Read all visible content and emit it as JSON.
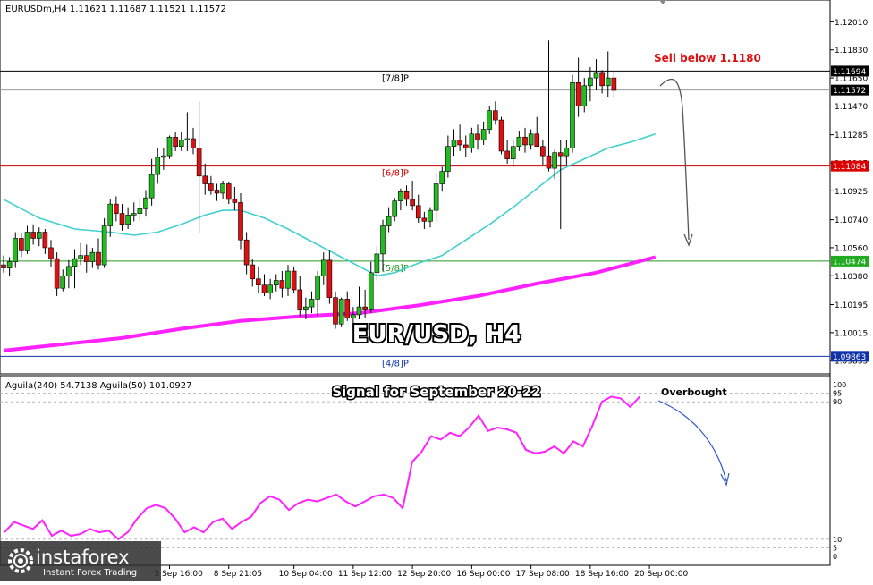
{
  "header": {
    "symbol_line": "EURUSDm,H4  1.11621 1.11687 1.11521 1.11572",
    "indicator_line": "Aguila(240) 54.7138  Aguila(50) 101.0927"
  },
  "title": "EUR/USD, H4",
  "subtitle": "Signal for September  20-22",
  "annotations": {
    "sell": "Sell below 1.1180",
    "overbought": "Overbought"
  },
  "levels": {
    "l78": {
      "label": "[7/8]P",
      "price": 1.11694,
      "tag": "1.11694"
    },
    "l68": {
      "label": "[6/8]P",
      "price": 1.11084,
      "tag": "1.11084"
    },
    "l58": {
      "label": "[5/8]P",
      "price": 1.10474,
      "tag": "1.10474"
    },
    "l48": {
      "label": "[4/8]P",
      "price": 1.09863,
      "tag": "1.09863"
    },
    "current": {
      "price": 1.11572,
      "tag": "1.11572"
    }
  },
  "colors": {
    "bull": "#22bb22",
    "bear": "#dd1111",
    "ma_slow": "#ff22ff",
    "ma_fast": "#40d0d0",
    "osc": "#ff22ff",
    "level_line": "#cc0000",
    "sell_text": "#dd1111",
    "green_tag": "#22aa22",
    "red_tag": "#dd0000",
    "blue_tag": "#1133aa"
  },
  "logo": {
    "brand": "instaforex",
    "tagline": "Instant Forex Trading"
  },
  "chart_data": {
    "type": "candlestick",
    "symbol": "EURUSDm",
    "timeframe": "H4",
    "ylim": [
      1.0975,
      1.1215
    ],
    "price_ticks": [
      "1.12010",
      "1.11830",
      "1.11650",
      "1.11470",
      "1.11285",
      "1.11105",
      "1.10925",
      "1.10740",
      "1.10560",
      "1.10380",
      "1.10195",
      "1.10015",
      "1.09835"
    ],
    "x_ticks": [
      "5 Sep 16:00",
      "8 Sep 21:05",
      "10 Sep 04:00",
      "11 Sep 12:00",
      "12 Sep 20:00",
      "16 Sep 00:00",
      "17 Sep 08:00",
      "18 Sep 16:00",
      "20 Sep 00:00"
    ],
    "x_tick_index": [
      28,
      38,
      49,
      59,
      69,
      79,
      89,
      99,
      109
    ],
    "candles": [
      [
        1.1045,
        1.1051,
        1.104,
        1.1043
      ],
      [
        1.1043,
        1.105,
        1.1038,
        1.1047
      ],
      [
        1.1047,
        1.1066,
        1.1043,
        1.1062
      ],
      [
        1.1062,
        1.1065,
        1.105,
        1.1054
      ],
      [
        1.1054,
        1.107,
        1.1052,
        1.1066
      ],
      [
        1.1066,
        1.1071,
        1.1058,
        1.1062
      ],
      [
        1.1062,
        1.1069,
        1.1057,
        1.1066
      ],
      [
        1.1066,
        1.1068,
        1.1052,
        1.1056
      ],
      [
        1.1056,
        1.1061,
        1.1044,
        1.1049
      ],
      [
        1.1049,
        1.1053,
        1.1025,
        1.103
      ],
      [
        1.103,
        1.1042,
        1.1028,
        1.1038
      ],
      [
        1.1038,
        1.1048,
        1.103,
        1.1044
      ],
      [
        1.1044,
        1.1055,
        1.103,
        1.1049
      ],
      [
        1.1049,
        1.1059,
        1.1045,
        1.1051
      ],
      [
        1.1051,
        1.1058,
        1.104,
        1.1047
      ],
      [
        1.1047,
        1.1056,
        1.1043,
        1.1053
      ],
      [
        1.1053,
        1.1062,
        1.1042,
        1.1045
      ],
      [
        1.1045,
        1.1075,
        1.1043,
        1.107
      ],
      [
        1.107,
        1.1087,
        1.1063,
        1.1084
      ],
      [
        1.1084,
        1.1089,
        1.1073,
        1.1078
      ],
      [
        1.1078,
        1.1084,
        1.1067,
        1.1071
      ],
      [
        1.1071,
        1.1082,
        1.1068,
        1.1077
      ],
      [
        1.1077,
        1.1085,
        1.1073,
        1.1078
      ],
      [
        1.1078,
        1.1087,
        1.1073,
        1.1081
      ],
      [
        1.1081,
        1.1093,
        1.1076,
        1.1088
      ],
      [
        1.1088,
        1.1113,
        1.1083,
        1.1103
      ],
      [
        1.1103,
        1.112,
        1.1097,
        1.1114
      ],
      [
        1.1114,
        1.112,
        1.1106,
        1.1115
      ],
      [
        1.1115,
        1.1128,
        1.1113,
        1.1127
      ],
      [
        1.1127,
        1.113,
        1.1118,
        1.1121
      ],
      [
        1.1121,
        1.113,
        1.1118,
        1.1125
      ],
      [
        1.1125,
        1.1143,
        1.1118,
        1.1126
      ],
      [
        1.1126,
        1.1133,
        1.1116,
        1.112
      ],
      [
        1.112,
        1.115,
        1.1065,
        1.1102
      ],
      [
        1.1102,
        1.111,
        1.109,
        1.1097
      ],
      [
        1.1097,
        1.1102,
        1.109,
        1.1093
      ],
      [
        1.1093,
        1.1097,
        1.1086,
        1.1091
      ],
      [
        1.1091,
        1.1099,
        1.1087,
        1.1097
      ],
      [
        1.1097,
        1.1098,
        1.1084,
        1.1087
      ],
      [
        1.1087,
        1.1095,
        1.108,
        1.1085
      ],
      [
        1.1085,
        1.1091,
        1.1055,
        1.1061
      ],
      [
        1.1061,
        1.1066,
        1.1039,
        1.1045
      ],
      [
        1.1045,
        1.1049,
        1.1031,
        1.1036
      ],
      [
        1.1036,
        1.1044,
        1.1027,
        1.1032
      ],
      [
        1.1032,
        1.1039,
        1.1025,
        1.1027
      ],
      [
        1.1027,
        1.1036,
        1.1023,
        1.1032
      ],
      [
        1.1032,
        1.1039,
        1.1028,
        1.1035
      ],
      [
        1.1035,
        1.1041,
        1.1024,
        1.103
      ],
      [
        1.103,
        1.1045,
        1.1025,
        1.1041
      ],
      [
        1.1041,
        1.1044,
        1.1027,
        1.1029
      ],
      [
        1.1029,
        1.1038,
        1.1012,
        1.1016
      ],
      [
        1.1016,
        1.1024,
        1.101,
        1.1018
      ],
      [
        1.1018,
        1.1028,
        1.1014,
        1.1023
      ],
      [
        1.1023,
        1.1041,
        1.1012,
        1.1038
      ],
      [
        1.1038,
        1.1053,
        1.1032,
        1.1048
      ],
      [
        1.1048,
        1.1054,
        1.102,
        1.1024
      ],
      [
        1.1024,
        1.1028,
        1.1004,
        1.1007
      ],
      [
        1.1007,
        1.1024,
        1.1005,
        1.1023
      ],
      [
        1.1023,
        1.1028,
        1.1009,
        1.1011
      ],
      [
        1.1011,
        1.1018,
        1.1003,
        1.1013
      ],
      [
        1.1013,
        1.1031,
        1.101,
        1.1018
      ],
      [
        1.1018,
        1.1029,
        1.1011,
        1.1016
      ],
      [
        1.1016,
        1.1047,
        1.1014,
        1.104
      ],
      [
        1.104,
        1.1057,
        1.1035,
        1.1052
      ],
      [
        1.1052,
        1.1074,
        1.1041,
        1.107
      ],
      [
        1.107,
        1.1082,
        1.1066,
        1.1076
      ],
      [
        1.1076,
        1.1088,
        1.1073,
        1.1086
      ],
      [
        1.1086,
        1.1094,
        1.108,
        1.1092
      ],
      [
        1.1092,
        1.1096,
        1.1083,
        1.1087
      ],
      [
        1.1087,
        1.1099,
        1.108,
        1.1083
      ],
      [
        1.1083,
        1.109,
        1.1072,
        1.1075
      ],
      [
        1.1075,
        1.1079,
        1.1068,
        1.1073
      ],
      [
        1.1073,
        1.1082,
        1.1069,
        1.108
      ],
      [
        1.108,
        1.1104,
        1.1073,
        1.1097
      ],
      [
        1.1097,
        1.1108,
        1.1092,
        1.1105
      ],
      [
        1.1105,
        1.1128,
        1.1101,
        1.1121
      ],
      [
        1.1121,
        1.1132,
        1.1115,
        1.1125
      ],
      [
        1.1125,
        1.1135,
        1.1118,
        1.1122
      ],
      [
        1.1122,
        1.1128,
        1.1114,
        1.112
      ],
      [
        1.112,
        1.1133,
        1.1117,
        1.1129
      ],
      [
        1.1129,
        1.1135,
        1.1119,
        1.1125
      ],
      [
        1.1125,
        1.1137,
        1.1122,
        1.1132
      ],
      [
        1.1132,
        1.1147,
        1.1129,
        1.1144
      ],
      [
        1.1144,
        1.115,
        1.1135,
        1.1138
      ],
      [
        1.1138,
        1.114,
        1.1116,
        1.1118
      ],
      [
        1.1118,
        1.1125,
        1.111,
        1.1113
      ],
      [
        1.1113,
        1.1125,
        1.1108,
        1.1121
      ],
      [
        1.1121,
        1.1131,
        1.1118,
        1.1127
      ],
      [
        1.1127,
        1.1133,
        1.1117,
        1.1122
      ],
      [
        1.1122,
        1.1132,
        1.1119,
        1.1129
      ],
      [
        1.1129,
        1.114,
        1.1126,
        1.1121
      ],
      [
        1.1121,
        1.1125,
        1.1109,
        1.1115
      ],
      [
        1.1115,
        1.1189,
        1.1105,
        1.1107
      ],
      [
        1.1107,
        1.1119,
        1.11,
        1.1117
      ],
      [
        1.1117,
        1.1125,
        1.1068,
        1.1115
      ],
      [
        1.1115,
        1.1125,
        1.1109,
        1.112
      ],
      [
        1.112,
        1.1167,
        1.1117,
        1.1162
      ],
      [
        1.1162,
        1.1178,
        1.114,
        1.1147
      ],
      [
        1.1147,
        1.1165,
        1.1143,
        1.116
      ],
      [
        1.116,
        1.1172,
        1.115,
        1.1165
      ],
      [
        1.1165,
        1.1177,
        1.1157,
        1.1168
      ],
      [
        1.1168,
        1.117,
        1.1155,
        1.116
      ],
      [
        1.116,
        1.1182,
        1.1153,
        1.1165
      ],
      [
        1.1165,
        1.1169,
        1.1152,
        1.1157
      ]
    ],
    "ma_fast": [
      [
        0,
        1.1087
      ],
      [
        6,
        1.1075
      ],
      [
        12,
        1.1068
      ],
      [
        18,
        1.1066
      ],
      [
        22,
        1.1064
      ],
      [
        26,
        1.1066
      ],
      [
        30,
        1.1071
      ],
      [
        34,
        1.1077
      ],
      [
        37,
        1.108
      ],
      [
        40,
        1.108
      ],
      [
        44,
        1.1075
      ],
      [
        48,
        1.1068
      ],
      [
        52,
        1.106
      ],
      [
        56,
        1.1052
      ],
      [
        60,
        1.1044
      ],
      [
        63,
        1.1038
      ],
      [
        66,
        1.104
      ],
      [
        70,
        1.1046
      ],
      [
        74,
        1.1051
      ],
      [
        78,
        1.1061
      ],
      [
        82,
        1.1071
      ],
      [
        86,
        1.1082
      ],
      [
        90,
        1.1094
      ],
      [
        94,
        1.1106
      ],
      [
        98,
        1.1113
      ],
      [
        102,
        1.112
      ],
      [
        106,
        1.1124
      ],
      [
        110,
        1.1129
      ]
    ],
    "ma_slow": [
      [
        0,
        1.099
      ],
      [
        10,
        1.0994
      ],
      [
        20,
        1.0998
      ],
      [
        30,
        1.1004
      ],
      [
        40,
        1.1009
      ],
      [
        50,
        1.1012
      ],
      [
        60,
        1.1014
      ],
      [
        70,
        1.1019
      ],
      [
        80,
        1.1025
      ],
      [
        90,
        1.1033
      ],
      [
        100,
        1.104
      ],
      [
        110,
        1.105
      ]
    ],
    "oscillator": {
      "ylim": [
        0,
        100
      ],
      "levels": [
        95,
        90,
        10,
        5
      ],
      "values": [
        [
          0,
          14
        ],
        [
          2,
          20
        ],
        [
          4,
          18
        ],
        [
          6,
          16
        ],
        [
          8,
          21
        ],
        [
          10,
          12
        ],
        [
          12,
          15
        ],
        [
          14,
          12
        ],
        [
          16,
          13
        ],
        [
          18,
          16
        ],
        [
          20,
          14
        ],
        [
          22,
          15
        ],
        [
          24,
          10
        ],
        [
          26,
          14
        ],
        [
          28,
          22
        ],
        [
          30,
          28
        ],
        [
          32,
          30
        ],
        [
          34,
          28
        ],
        [
          36,
          22
        ],
        [
          38,
          14
        ],
        [
          40,
          17
        ],
        [
          42,
          14
        ],
        [
          44,
          20
        ],
        [
          46,
          22
        ],
        [
          48,
          16
        ],
        [
          50,
          20
        ],
        [
          52,
          23
        ],
        [
          54,
          31
        ],
        [
          56,
          35
        ],
        [
          58,
          33
        ],
        [
          60,
          27
        ],
        [
          62,
          31
        ],
        [
          64,
          33
        ],
        [
          66,
          32
        ],
        [
          68,
          34
        ],
        [
          70,
          36
        ],
        [
          72,
          32
        ],
        [
          74,
          29
        ],
        [
          76,
          32
        ],
        [
          78,
          35
        ],
        [
          80,
          36
        ],
        [
          82,
          34
        ],
        [
          84,
          28
        ],
        [
          86,
          55
        ],
        [
          88,
          61
        ],
        [
          90,
          70
        ],
        [
          92,
          68
        ],
        [
          94,
          72
        ],
        [
          96,
          70
        ],
        [
          98,
          75
        ],
        [
          100,
          82
        ],
        [
          102,
          73
        ],
        [
          104,
          75
        ],
        [
          106,
          74
        ],
        [
          108,
          72
        ],
        [
          110,
          62
        ],
        [
          112,
          60
        ],
        [
          114,
          61
        ],
        [
          116,
          64
        ],
        [
          118,
          60
        ],
        [
          120,
          67
        ],
        [
          122,
          64
        ],
        [
          124,
          76
        ],
        [
          126,
          90
        ],
        [
          128,
          93
        ],
        [
          130,
          92
        ],
        [
          132,
          87
        ],
        [
          134,
          93
        ]
      ]
    }
  }
}
